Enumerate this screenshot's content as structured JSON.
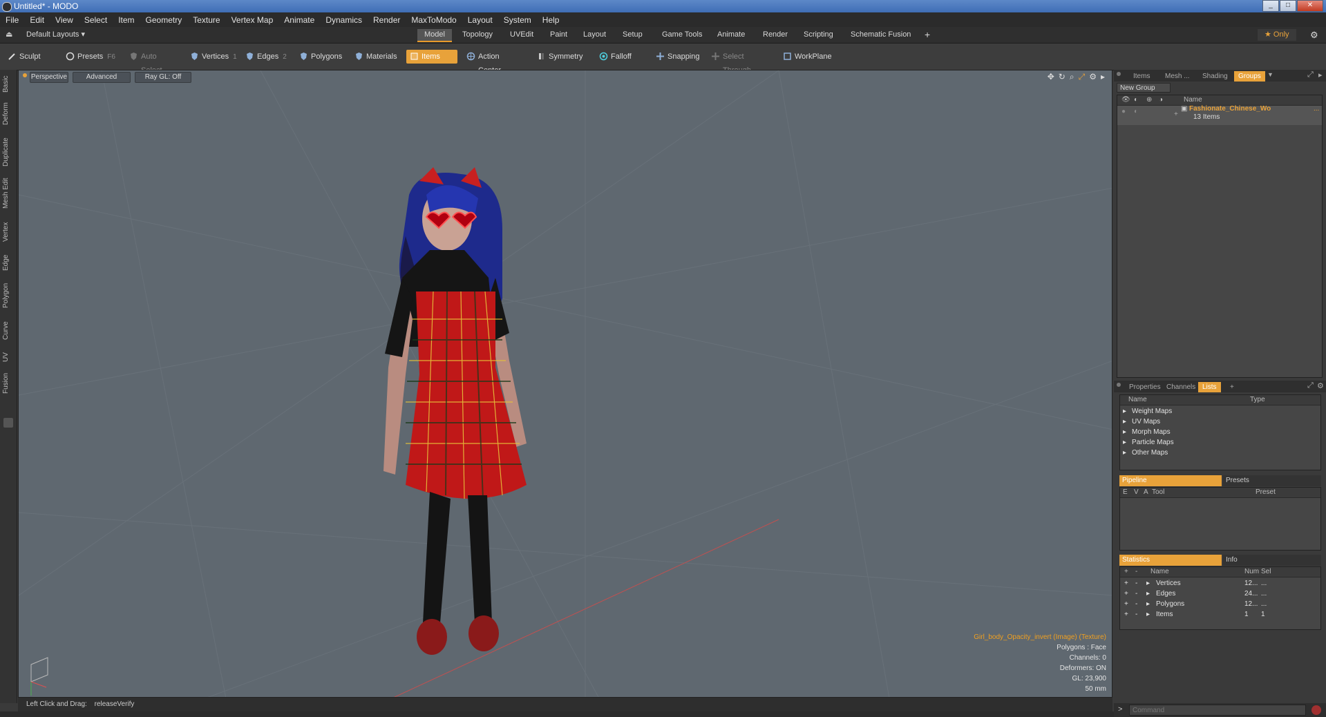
{
  "window": {
    "title": "Untitled* - MODO",
    "min": "_",
    "max": "□",
    "close": "✕"
  },
  "menu": [
    "File",
    "Edit",
    "View",
    "Select",
    "Item",
    "Geometry",
    "Texture",
    "Vertex Map",
    "Animate",
    "Dynamics",
    "Render",
    "MaxToModo",
    "Layout",
    "System",
    "Help"
  ],
  "layouts": {
    "label": "Default Layouts ▾"
  },
  "mode_tabs": [
    "Model",
    "Topology",
    "UVEdit",
    "Paint",
    "Layout",
    "Setup",
    "Game Tools",
    "Animate",
    "Render",
    "Scripting",
    "Schematic Fusion"
  ],
  "mode_tab_active": "Model",
  "add_tab": "+",
  "only_label": "★ Only",
  "toolbar": {
    "sculpt": "Sculpt",
    "presets": "Presets",
    "presets_key": "F6",
    "auto_select": "Auto Select",
    "vertices": "Vertices",
    "vertices_key": "1",
    "edges": "Edges",
    "edges_key": "2",
    "polygons": "Polygons",
    "materials": "Materials",
    "items": "Items",
    "action_center": "Action Center",
    "symmetry": "Symmetry",
    "falloff": "Falloff",
    "snapping": "Snapping",
    "select_through": "Select Through",
    "workplane": "WorkPlane"
  },
  "left_tabs": [
    "Basic",
    "Deform",
    "Duplicate",
    "Mesh Edit",
    "Vertex",
    "Edge",
    "Polygon",
    "Curve",
    "UV",
    "Fusion"
  ],
  "viewport": {
    "perspective": "Perspective",
    "advanced": "Advanced",
    "raygl": "Ray GL: Off",
    "info": {
      "texture": "Girl_body_Opacity_invert (Image) (Texture)",
      "polygons": "Polygons : Face",
      "channels": "Channels: 0",
      "deformers": "Deformers: ON",
      "gl": "GL: 23,900",
      "size": "50 mm"
    }
  },
  "status": {
    "hint": "Left Click and Drag:",
    "action": "releaseVerify"
  },
  "groups_panel": {
    "tabs": [
      "Items",
      "Mesh ...",
      "Shading",
      "Groups"
    ],
    "active": "Groups",
    "new_group": "New Group",
    "name_header": "Name",
    "group_name": "Fashionate_Chinese_Wo",
    "group_more": "...",
    "group_count": "13 Items"
  },
  "lists_panel": {
    "tabs": [
      "Properties",
      "Channels",
      "Lists"
    ],
    "active": "Lists",
    "add": "+",
    "headers": {
      "name": "Name",
      "type": "Type"
    },
    "items": [
      "Weight Maps",
      "UV Maps",
      "Morph Maps",
      "Particle Maps",
      "Other Maps"
    ]
  },
  "pipeline_panel": {
    "tab_active": "Pipeline",
    "tab_other": "Presets",
    "headers": {
      "e": "E",
      "v": "V",
      "a": "A",
      "tool": "Tool",
      "preset": "Preset"
    }
  },
  "stats_panel": {
    "tab_active": "Statistics",
    "tab_other": "Info",
    "headers": {
      "plus": "+",
      "minus": "-",
      "name": "Name",
      "num": "Num",
      "sel": "Sel"
    },
    "rows": [
      {
        "name": "Vertices",
        "num": "12...",
        "sel": "..."
      },
      {
        "name": "Edges",
        "num": "24...",
        "sel": "..."
      },
      {
        "name": "Polygons",
        "num": "12...",
        "sel": "..."
      },
      {
        "name": "Items",
        "num": "1",
        "sel": "1"
      }
    ]
  },
  "command": {
    "placeholder": "Command",
    "prompt": ">"
  }
}
